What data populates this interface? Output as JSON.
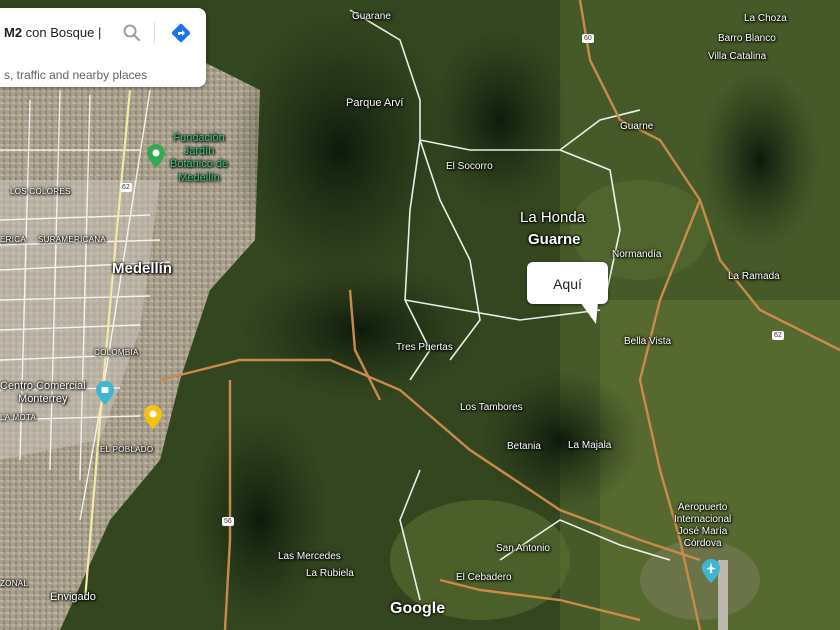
{
  "search": {
    "query_bold": "M2",
    "query_rest": " con Bosque |",
    "subtitle": "s, traffic and nearby places"
  },
  "icons": {
    "search": "search-icon",
    "directions": "directions-icon",
    "pin_garden": "garden-pin-icon",
    "pin_mall": "shopping-pin-icon",
    "pin_yellow": "place-pin-icon",
    "pin_airport": "airport-pin-icon"
  },
  "colors": {
    "poi_green": "#34c77b",
    "pin_teal": "#3fb6d1",
    "pin_yellow": "#f4c20d",
    "road_orange": "#c98a4b",
    "road_white": "#ffffff"
  },
  "marker": {
    "label": "Aquí"
  },
  "places": {
    "guarane": "Guarane",
    "parque_arvi": "Parque Arví",
    "fundacion": "Fundación\nJardín\nBotánico de\nMedellín",
    "los_colores": "LOS COLORES",
    "america": "ERICA",
    "suramericana": "SURAMERICANA",
    "medellin": "Medellín",
    "colombia": "COLOMBIA",
    "centro_comercial": "Centro Comercial\nMonterrey",
    "la_mota": "LA MOTA",
    "el_poblado": "EL POBLADO",
    "envigado": "Envigado",
    "zonal": "ZONAL",
    "el_socorro": "El Socorro",
    "la_honda": "La Honda",
    "guarne_big": "Guarne",
    "guarne_small": "Guarne",
    "normandia": "Normandía",
    "la_ramada": "La Ramada",
    "bella_vista": "Bella Vista",
    "tres_puertas": "Tres Puertas",
    "los_tambores": "Los Tambores",
    "betania": "Betania",
    "la_majala": "La Majala",
    "aeropuerto": "Aeropuerto\nInternacional\nJosé María\nCórdova",
    "san_antonio": "San Antonio",
    "el_cebadero": "El Cebadero",
    "las_mercedes": "Las Mercedes",
    "la_rubiela": "La Rubiela",
    "la_choza": "La Choza",
    "barro_blanco": "Barro Blanco",
    "villa_catalina": "Villa Catalina"
  },
  "shields": {
    "r60": "60",
    "r62": "62",
    "r56": "56",
    "r62b": "62"
  },
  "attribution": "Google"
}
